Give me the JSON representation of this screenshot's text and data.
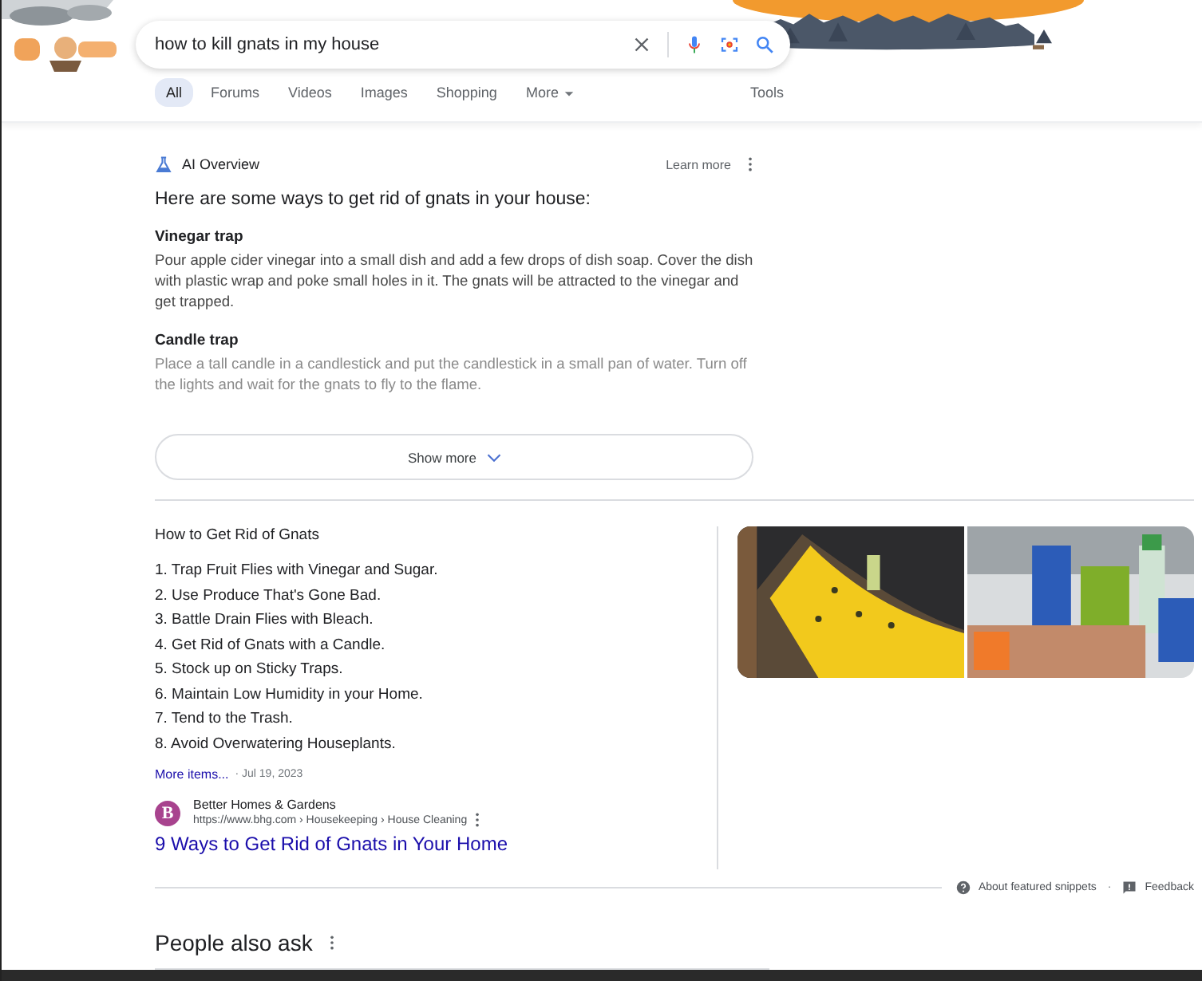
{
  "search": {
    "query": "how to kill gnats in my house"
  },
  "tabs": [
    {
      "label": "All",
      "selected": true
    },
    {
      "label": "Forums",
      "selected": false
    },
    {
      "label": "Videos",
      "selected": false
    },
    {
      "label": "Images",
      "selected": false
    },
    {
      "label": "Shopping",
      "selected": false
    },
    {
      "label": "More",
      "selected": false,
      "kind": "menu"
    }
  ],
  "tools": "Tools",
  "ai_overview": {
    "title": "AI Overview",
    "learn_more": "Learn more",
    "intro": "Here are some ways to get rid of gnats in your house:",
    "items": [
      {
        "heading": "Vinegar trap",
        "text": "Pour apple cider vinegar into a small dish and add a few drops of dish soap. Cover the dish with plastic wrap and poke small holes in it. The gnats will be attracted to the vinegar and get trapped.",
        "faded": false
      },
      {
        "heading": "Candle trap",
        "text": "Place a tall candle in a candlestick and put the candlestick in a small pan of water. Turn off the lights and wait for the gnats to fly to the flame.",
        "faded": true
      }
    ],
    "show_more": "Show more"
  },
  "snippet": {
    "title": "How to Get Rid of Gnats",
    "steps": [
      "1. Trap Fruit Flies with Vinegar and Sugar.",
      "2. Use Produce That's Gone Bad.",
      "3. Battle Drain Flies with Bleach.",
      "4. Get Rid of Gnats with a Candle.",
      "5. Stock up on Sticky Traps.",
      "6. Maintain Low Humidity in your Home.",
      "7. Tend to the Trash.",
      "8. Avoid Overwatering Houseplants."
    ],
    "more_items": "More items...",
    "date": "· Jul 19, 2023",
    "source": {
      "favicon": "B",
      "name": "Better Homes & Gardens",
      "url": "https://www.bhg.com › Housekeeping › House Cleaning",
      "link": "9 Ways to Get Rid of Gnats in Your Home"
    }
  },
  "footer": {
    "about": "About featured snippets",
    "separator": "·",
    "feedback": "Feedback"
  },
  "people_also_ask": "People also ask"
}
